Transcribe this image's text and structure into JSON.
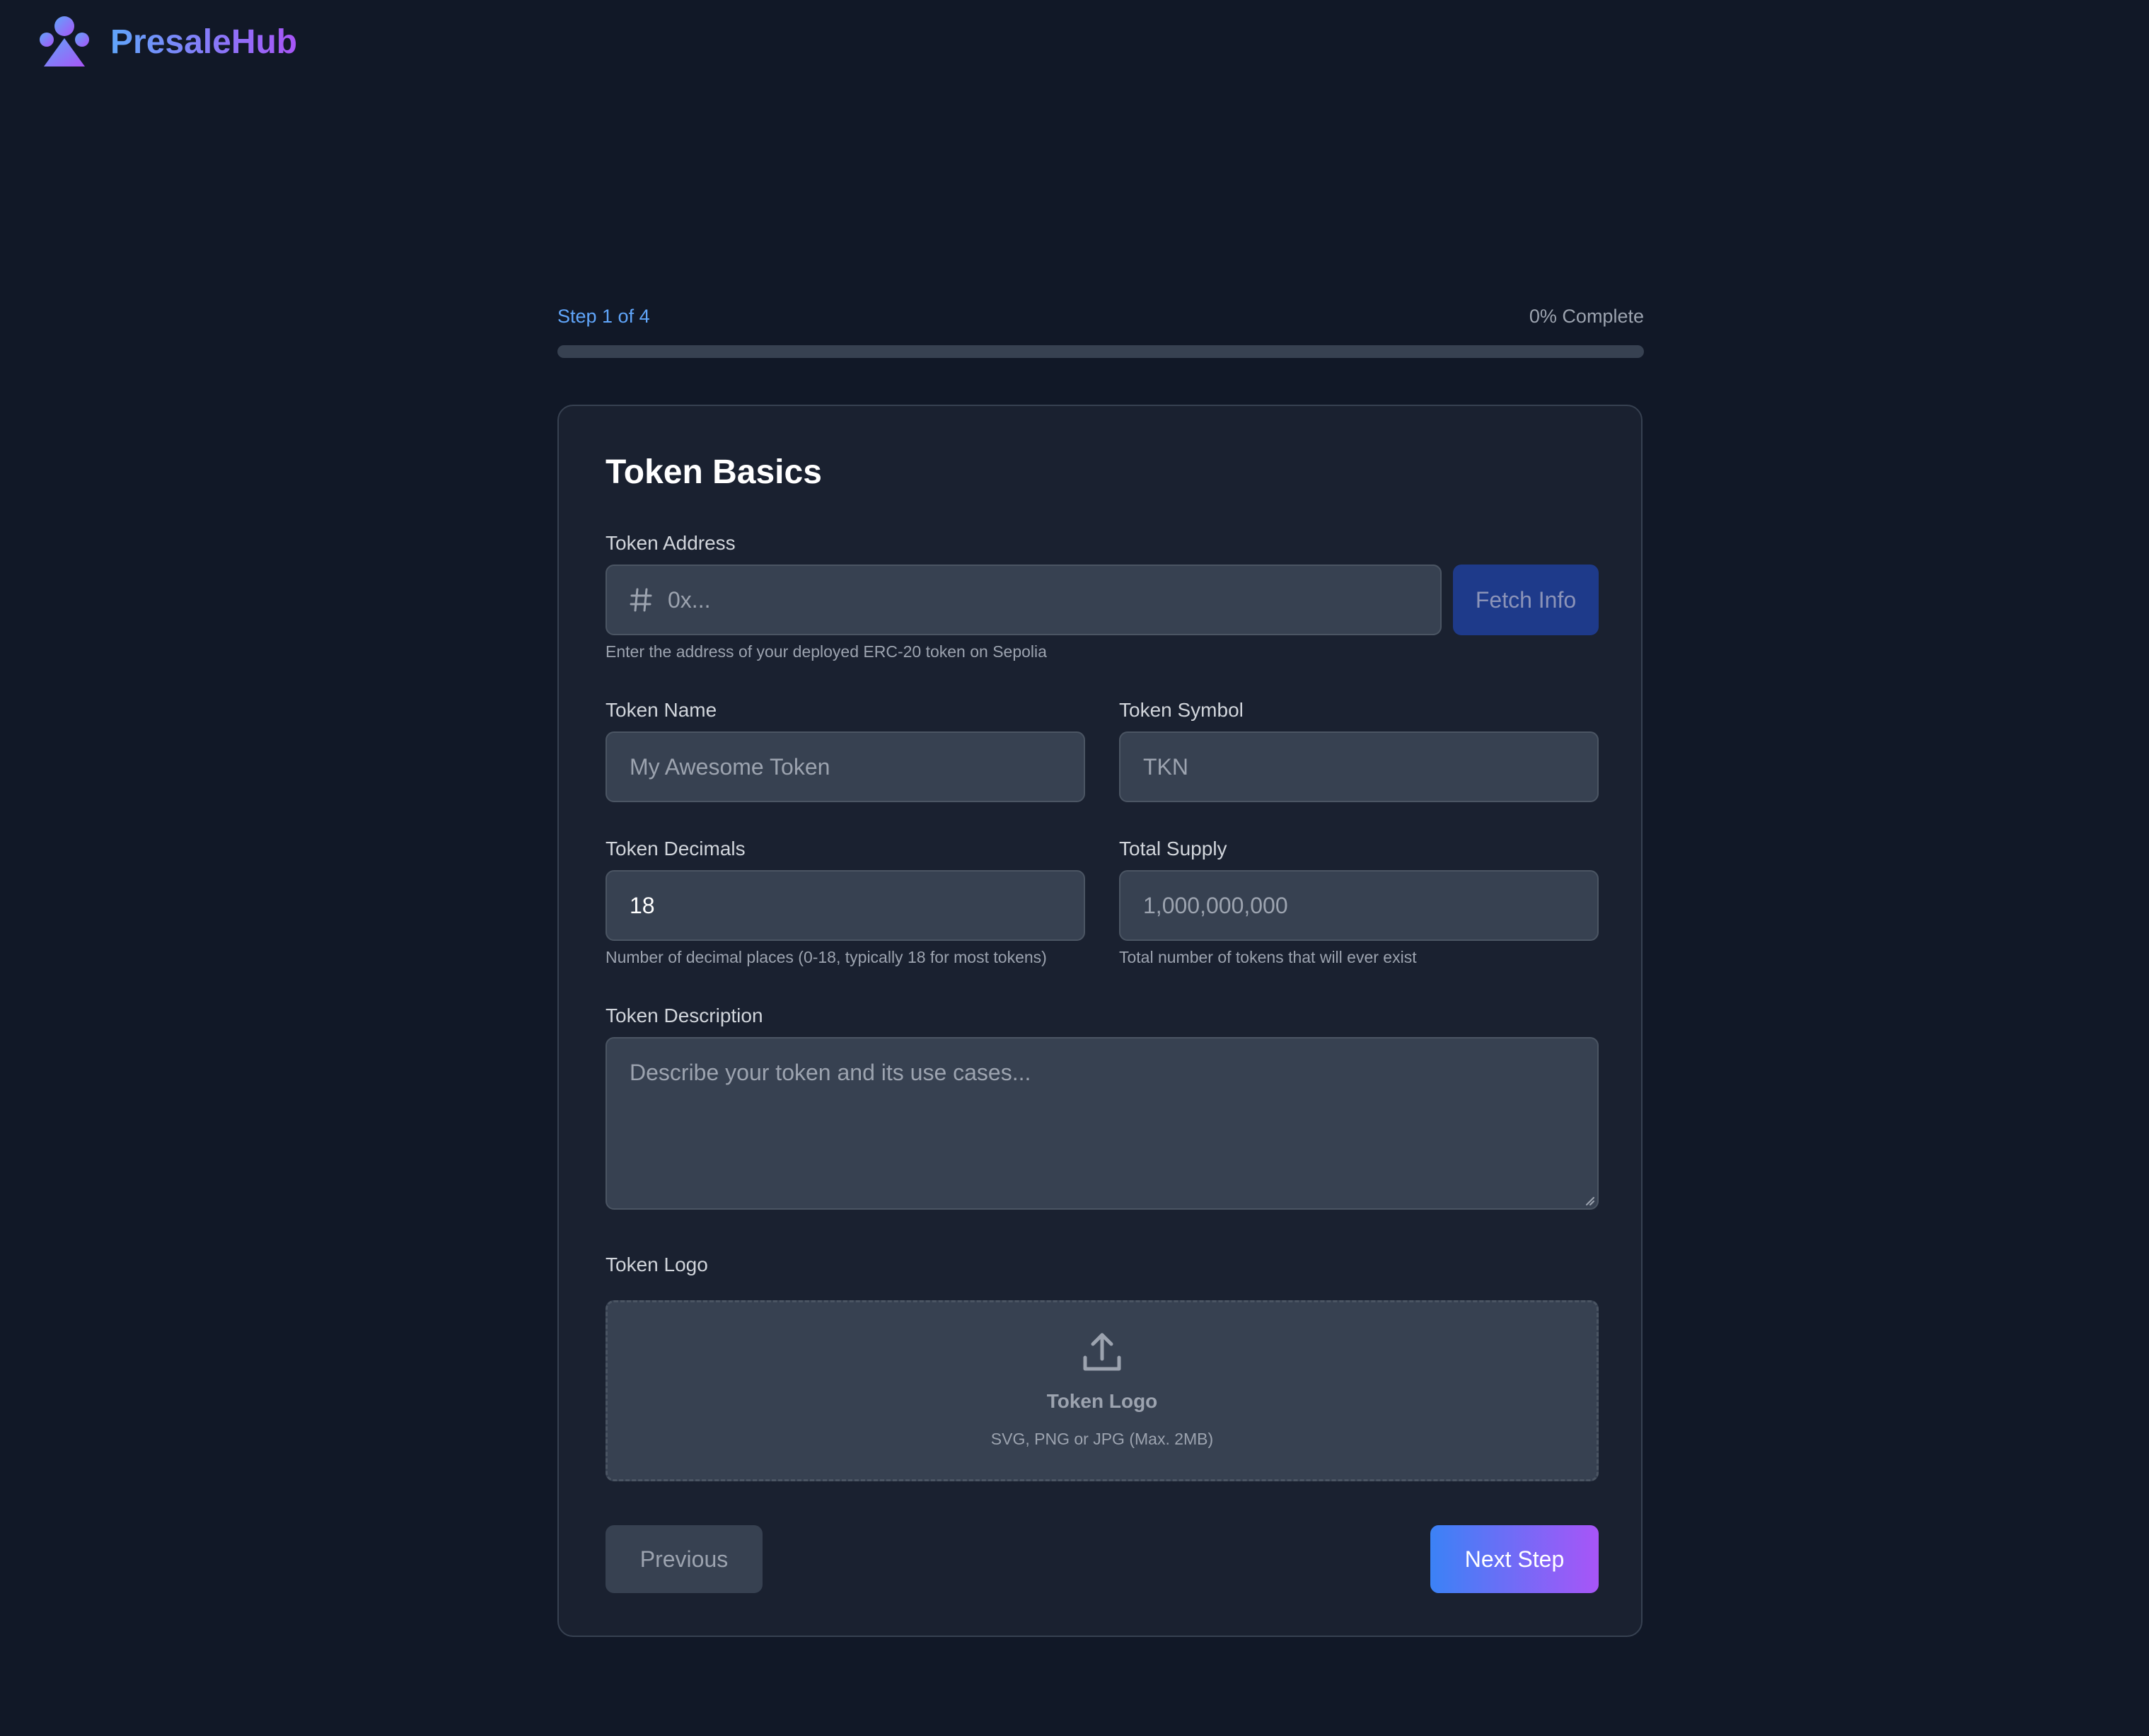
{
  "brand": {
    "name": "PresaleHub",
    "icon": "users-icon"
  },
  "progress": {
    "step_label": "Step 1 of 4",
    "complete_label": "0% Complete",
    "percent": 0
  },
  "form": {
    "title": "Token Basics",
    "token_address": {
      "label": "Token Address",
      "placeholder": "0x...",
      "icon": "hash-icon",
      "hint": "Enter the address of your deployed ERC-20 token on Sepolia",
      "fetch_label": "Fetch Info"
    },
    "token_name": {
      "label": "Token Name",
      "placeholder": "My Awesome Token"
    },
    "token_symbol": {
      "label": "Token Symbol",
      "placeholder": "TKN"
    },
    "token_decimals": {
      "label": "Token Decimals",
      "value": "18",
      "hint": "Number of decimal places (0-18, typically 18 for most tokens)"
    },
    "total_supply": {
      "label": "Total Supply",
      "placeholder": "1,000,000,000",
      "hint": "Total number of tokens that will ever exist"
    },
    "token_description": {
      "label": "Token Description",
      "placeholder": "Describe your token and its use cases..."
    },
    "token_logo": {
      "label": "Token Logo",
      "upload_title": "Token Logo",
      "upload_hint": "SVG, PNG or JPG (Max. 2MB)",
      "icon": "upload-icon"
    },
    "previous_label": "Previous",
    "next_label": "Next Step"
  },
  "colors": {
    "background": "#111827",
    "card": "#1a2130",
    "input": "#374151",
    "accent_blue": "#60a5fa",
    "accent_purple": "#a855f7",
    "fetch_button": "#1e3a8a"
  }
}
